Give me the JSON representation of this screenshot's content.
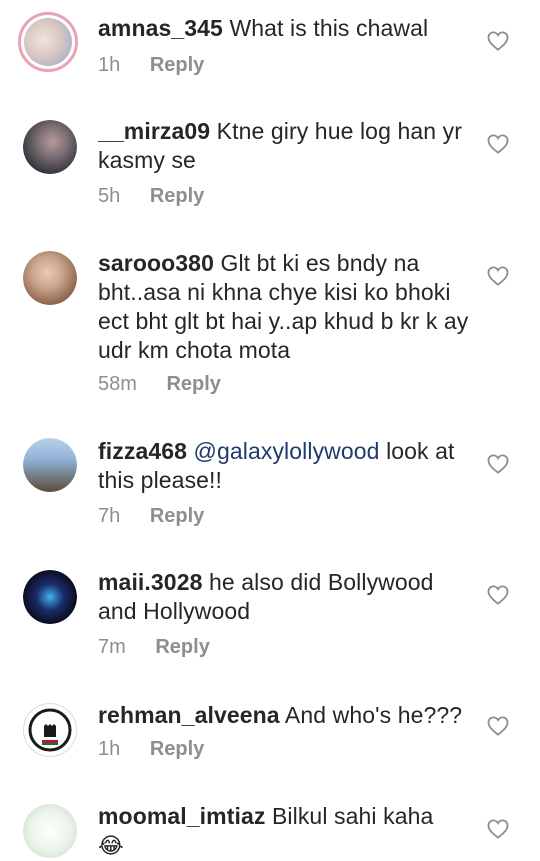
{
  "comments": [
    {
      "username": "amnas_345",
      "text": "What is this chawal",
      "time": "1h",
      "reply_label": "Reply",
      "avatar_icon": "profile-photo-baby",
      "avatar_colors": [
        "#d9c7c2",
        "#8aa7c9"
      ]
    },
    {
      "username": "__mirza09",
      "text": "Ktne giry hue log han yr kasmy se",
      "time": "5h",
      "reply_label": "Reply",
      "avatar_icon": "profile-photo-man",
      "avatar_colors": [
        "#2a2a33",
        "#7a6e74"
      ]
    },
    {
      "username": "sarooo380",
      "text": "Glt bt ki es bndy na bht..asa ni khna chye kisi ko bhoki ect bht glt bt hai y..ap khud b kr k ay udr km chota mota",
      "time": "58m",
      "reply_label": "Reply",
      "avatar_icon": "profile-photo-woman",
      "avatar_colors": [
        "#c9a48a",
        "#7a4e3a"
      ]
    },
    {
      "username": "fizza468",
      "mention": "@galaxylollywood",
      "text": "look at this please!!",
      "time": "7h",
      "reply_label": "Reply",
      "avatar_icon": "profile-photo-couple",
      "avatar_colors": [
        "#8fb2d6",
        "#5b4a3c"
      ]
    },
    {
      "username": "maii.3028",
      "text": "he also did Bollywood and Hollywood",
      "time": "7m",
      "reply_label": "Reply",
      "avatar_icon": "profile-photo-neon-text",
      "avatar_colors": [
        "#0b0d1e",
        "#3fb4e8"
      ]
    },
    {
      "username": "rehman_alveena",
      "text": "And who's he???",
      "time": "1h",
      "reply_label": "Reply",
      "avatar_icon": "profile-photo-fist-badge",
      "avatar_colors": [
        "#ffffff",
        "#1a1a1a"
      ]
    },
    {
      "username": "moomal_imtiaz",
      "text": "Bilkul sahi kaha",
      "emoji": "😂",
      "time": "",
      "reply_label": "",
      "avatar_icon": "profile-photo-calligraphy",
      "avatar_colors": [
        "#eaf2ea",
        "#3a6a3a"
      ]
    }
  ],
  "heart_icon": "heart-outline-icon",
  "colors": {
    "text": "#262626",
    "meta": "#8e8e8e",
    "mention": "#1f3a6b"
  }
}
